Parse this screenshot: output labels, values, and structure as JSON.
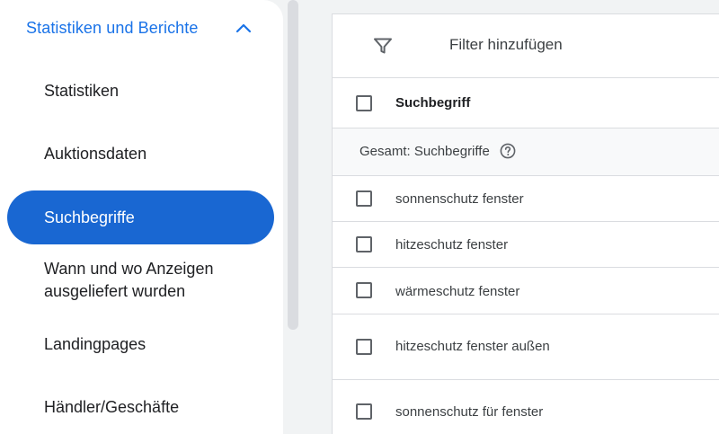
{
  "sidebar": {
    "section_title": "Statistiken und Berichte",
    "items": [
      {
        "label": "Statistiken"
      },
      {
        "label": "Auktionsdaten"
      },
      {
        "label": "Suchbegriffe",
        "active": true
      },
      {
        "label_line1": "Wann und wo Anzeigen",
        "label_line2": "ausgeliefert wurden"
      },
      {
        "label": "Landingpages"
      },
      {
        "label": "Händler/Geschäfte"
      }
    ]
  },
  "toolbar": {
    "filter_label": "Filter hinzufügen"
  },
  "table": {
    "header": "Suchbegriff",
    "total_label": "Gesamt: Suchbegriffe",
    "rows": [
      "sonnenschutz fenster",
      "hitzeschutz fenster",
      "wärmeschutz fenster",
      "hitzeschutz fenster außen",
      "sonnenschutz für fenster"
    ]
  },
  "colors": {
    "accent": "#1a73e8",
    "active_pill": "#1967d2",
    "background": "#f1f3f4"
  },
  "icons": [
    "chevron-up-icon",
    "filter-icon",
    "help-icon",
    "checkbox-icon"
  ]
}
